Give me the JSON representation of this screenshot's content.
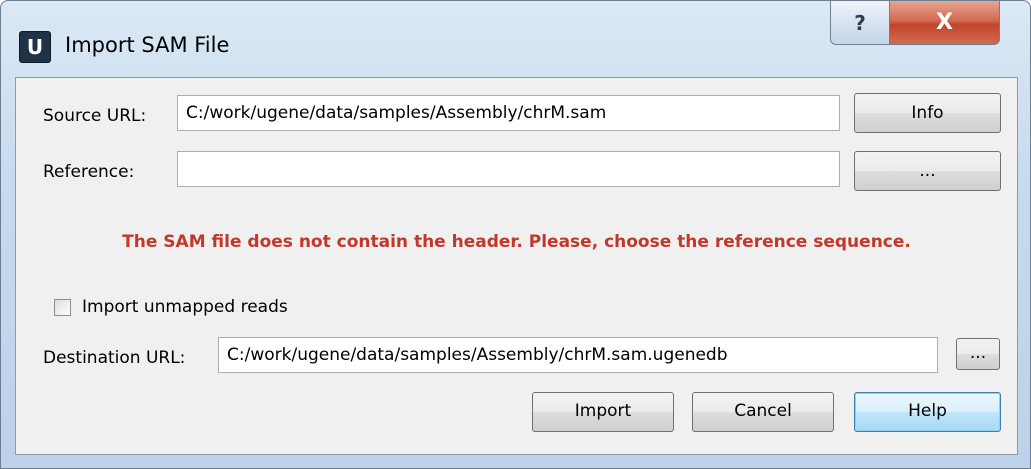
{
  "window": {
    "title": "Import SAM File",
    "logo_letter": "U",
    "help_glyph": "?",
    "close_glyph": "X"
  },
  "source": {
    "label": "Source URL:",
    "value": "C:/work/ugene/data/samples/Assembly/chrM.sam",
    "info_button": "Info"
  },
  "reference": {
    "label": "Reference:",
    "value": "",
    "browse_button": "..."
  },
  "warning": {
    "text": "The SAM file does not contain the header. Please, choose the reference sequence.",
    "color": "#c0392b"
  },
  "options": {
    "import_unmapped_label": "Import unmapped reads",
    "import_unmapped_checked": false
  },
  "destination": {
    "label": "Destination URL:",
    "value": "C:/work/ugene/data/samples/Assembly/chrM.sam.ugenedb",
    "browse_button": "..."
  },
  "buttons": {
    "import": "Import",
    "cancel": "Cancel",
    "help": "Help"
  }
}
